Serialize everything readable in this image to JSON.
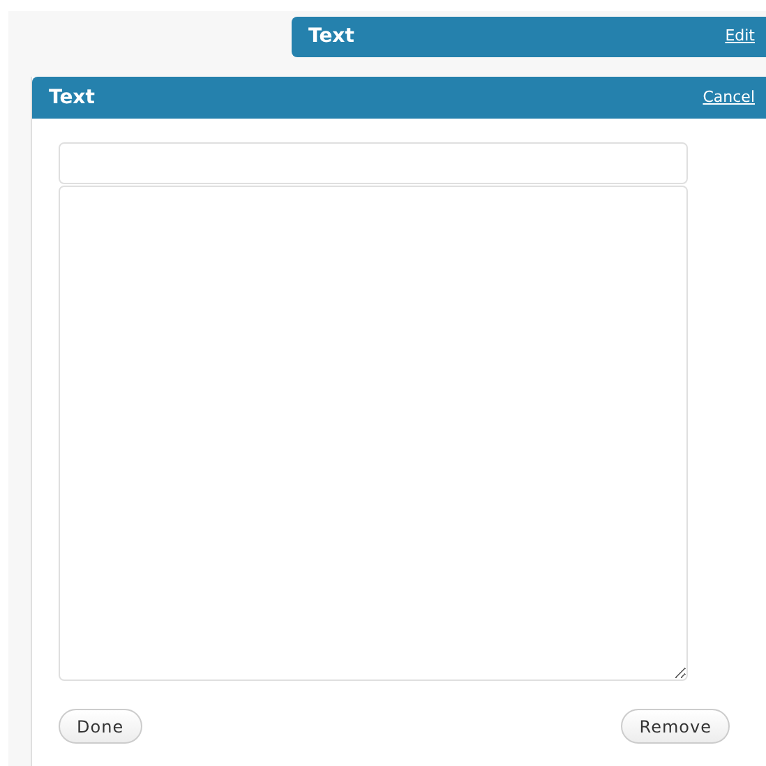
{
  "collapsed_widget": {
    "title": "Text",
    "action": "Edit"
  },
  "open_widget": {
    "title": "Text",
    "action": "Cancel",
    "buttons": [
      "Done",
      "Remove"
    ]
  }
}
